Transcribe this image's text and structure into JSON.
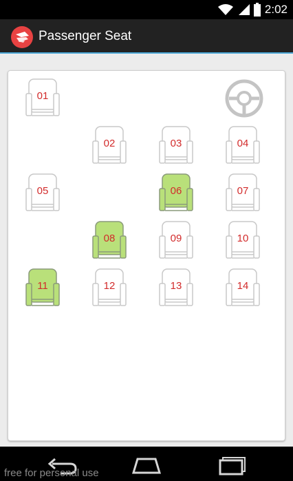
{
  "status": {
    "time": "2:02"
  },
  "app": {
    "title": "Passenger Seat",
    "accent": "#e84242"
  },
  "seats": [
    {
      "label": "01",
      "selected": false
    },
    {
      "label": "02",
      "selected": false
    },
    {
      "label": "03",
      "selected": false
    },
    {
      "label": "04",
      "selected": false
    },
    {
      "label": "05",
      "selected": false
    },
    {
      "label": "06",
      "selected": true
    },
    {
      "label": "07",
      "selected": false
    },
    {
      "label": "08",
      "selected": true
    },
    {
      "label": "09",
      "selected": false
    },
    {
      "label": "10",
      "selected": false
    },
    {
      "label": "11",
      "selected": true
    },
    {
      "label": "12",
      "selected": false
    },
    {
      "label": "13",
      "selected": false
    },
    {
      "label": "14",
      "selected": false
    }
  ],
  "colors": {
    "selected_fill": "#b9e07a",
    "selected_stroke": "#8a9a7a",
    "seat_stroke": "#c8c8c8",
    "seat_number": "#d22b2b"
  },
  "icons": {
    "driver": "steering-wheel-icon"
  },
  "watermark": "free for personal use"
}
